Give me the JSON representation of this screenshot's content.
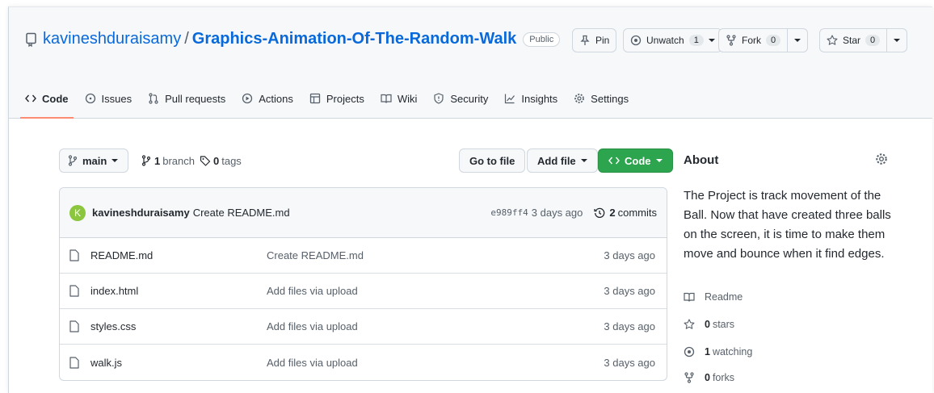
{
  "repo": {
    "owner": "kavineshduraisamy",
    "separator": "/",
    "name": "Graphics-Animation-Of-The-Random-Walk",
    "visibility": "Public"
  },
  "actions": {
    "pin_label": "Pin",
    "unwatch_label": "Unwatch",
    "unwatch_count": "1",
    "fork_label": "Fork",
    "fork_count": "0",
    "star_label": "Star",
    "star_count": "0"
  },
  "tabs": [
    {
      "label": "Code",
      "icon": "code-icon",
      "selected": true
    },
    {
      "label": "Issues",
      "icon": "issue-icon"
    },
    {
      "label": "Pull requests",
      "icon": "pull-request-icon"
    },
    {
      "label": "Actions",
      "icon": "play-icon"
    },
    {
      "label": "Projects",
      "icon": "table-icon"
    },
    {
      "label": "Wiki",
      "icon": "book-icon"
    },
    {
      "label": "Security",
      "icon": "shield-icon"
    },
    {
      "label": "Insights",
      "icon": "graph-icon"
    },
    {
      "label": "Settings",
      "icon": "gear-icon"
    }
  ],
  "toolbar": {
    "branch": "main",
    "branch_count": "1",
    "branch_word": "branch",
    "tag_count": "0",
    "tag_word": "tags",
    "go_to_file": "Go to file",
    "add_file": "Add file",
    "code_label": "Code"
  },
  "latest_commit": {
    "avatar_letter": "K",
    "author": "kavineshduraisamy",
    "message": "Create README.md",
    "sha": "e989ff4",
    "time": "3 days ago",
    "commit_count": "2",
    "commit_word": "commits"
  },
  "files": [
    {
      "name": "README.md",
      "message": "Create README.md",
      "time": "3 days ago"
    },
    {
      "name": "index.html",
      "message": "Add files via upload",
      "time": "3 days ago"
    },
    {
      "name": "styles.css",
      "message": "Add files via upload",
      "time": "3 days ago"
    },
    {
      "name": "walk.js",
      "message": "Add files via upload",
      "time": "3 days ago"
    }
  ],
  "about": {
    "title": "About",
    "description": "The Project is track movement of the Ball. Now that have created three balls on the screen, it is time to make them move and bounce when it find edges.",
    "readme_label": "Readme",
    "stars_count": "0",
    "stars_word": "stars",
    "watching_count": "1",
    "watching_word": "watching",
    "forks_count": "0",
    "forks_word": "forks"
  },
  "colors": {
    "link": "#0969da",
    "primary_button": "#2da44e",
    "selected_tab_underline": "#fd8c73",
    "avatar": "#8cc63f"
  }
}
